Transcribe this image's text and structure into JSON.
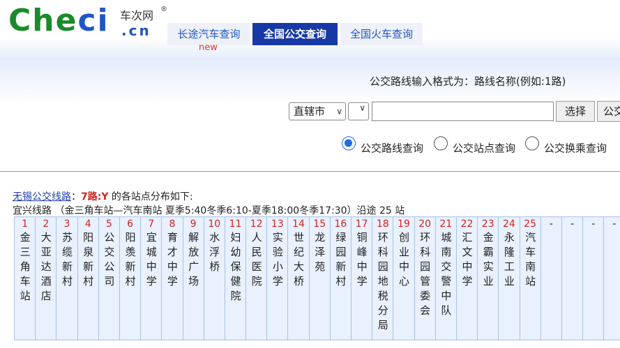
{
  "logo": {
    "brand_part1": "Che",
    "brand_part2": "ci",
    "chinese": "车次网",
    "domain": ".cn",
    "reg_mark": "®"
  },
  "tabs": [
    {
      "label": "长途汽车查询",
      "badge": "new"
    },
    {
      "label": "全国公交查询"
    },
    {
      "label": "全国火车查询"
    }
  ],
  "hint": "公交路线输入格式为：路线名称(例如:1路)",
  "form": {
    "city_select": "直辖市",
    "route_value": "",
    "select_button": "选择",
    "bus_button": "公交"
  },
  "radios": [
    {
      "label": "公交路线查询",
      "checked": true
    },
    {
      "label": "公交站点查询",
      "checked": false
    },
    {
      "label": "公交换乘查询",
      "checked": false
    }
  ],
  "result": {
    "city_link": "无锡公交线路",
    "sep": "：",
    "route": "7路:Y",
    "suffix": " 的各站点分布如下:",
    "summary": "宜兴线路  （金三角车站—汽车南站 夏季5:40冬季6:10-夏季18:00冬季17:30）沿途 25 站"
  },
  "stops": [
    {
      "num": "1",
      "name": "金三角车站"
    },
    {
      "num": "2",
      "name": "大亚达酒店"
    },
    {
      "num": "3",
      "name": "苏缆新村"
    },
    {
      "num": "4",
      "name": "阳泉新村"
    },
    {
      "num": "5",
      "name": "公交公司"
    },
    {
      "num": "6",
      "name": "阳羡新村"
    },
    {
      "num": "7",
      "name": "宜城中学"
    },
    {
      "num": "8",
      "name": "育才中学"
    },
    {
      "num": "9",
      "name": "解放广场"
    },
    {
      "num": "10",
      "name": "水浮桥"
    },
    {
      "num": "11",
      "name": "妇幼保健院"
    },
    {
      "num": "12",
      "name": "人民医院"
    },
    {
      "num": "13",
      "name": "实验小学"
    },
    {
      "num": "14",
      "name": "世纪大桥"
    },
    {
      "num": "15",
      "name": "龙泽苑"
    },
    {
      "num": "16",
      "name": "绿园新村"
    },
    {
      "num": "17",
      "name": "铜峰中学"
    },
    {
      "num": "18",
      "name": "环科园地税分局"
    },
    {
      "num": "19",
      "name": "创业中心"
    },
    {
      "num": "20",
      "name": "环科园管委会"
    },
    {
      "num": "21",
      "name": "城南交警中队"
    },
    {
      "num": "22",
      "name": "汇文中学"
    },
    {
      "num": "23",
      "name": "金霸实业"
    },
    {
      "num": "24",
      "name": "永隆工业"
    },
    {
      "num": "25",
      "name": "汽车南站"
    },
    {
      "num": "-",
      "name": ""
    },
    {
      "num": "-",
      "name": ""
    },
    {
      "num": "-",
      "name": ""
    },
    {
      "num": "-",
      "name": ""
    }
  ]
}
